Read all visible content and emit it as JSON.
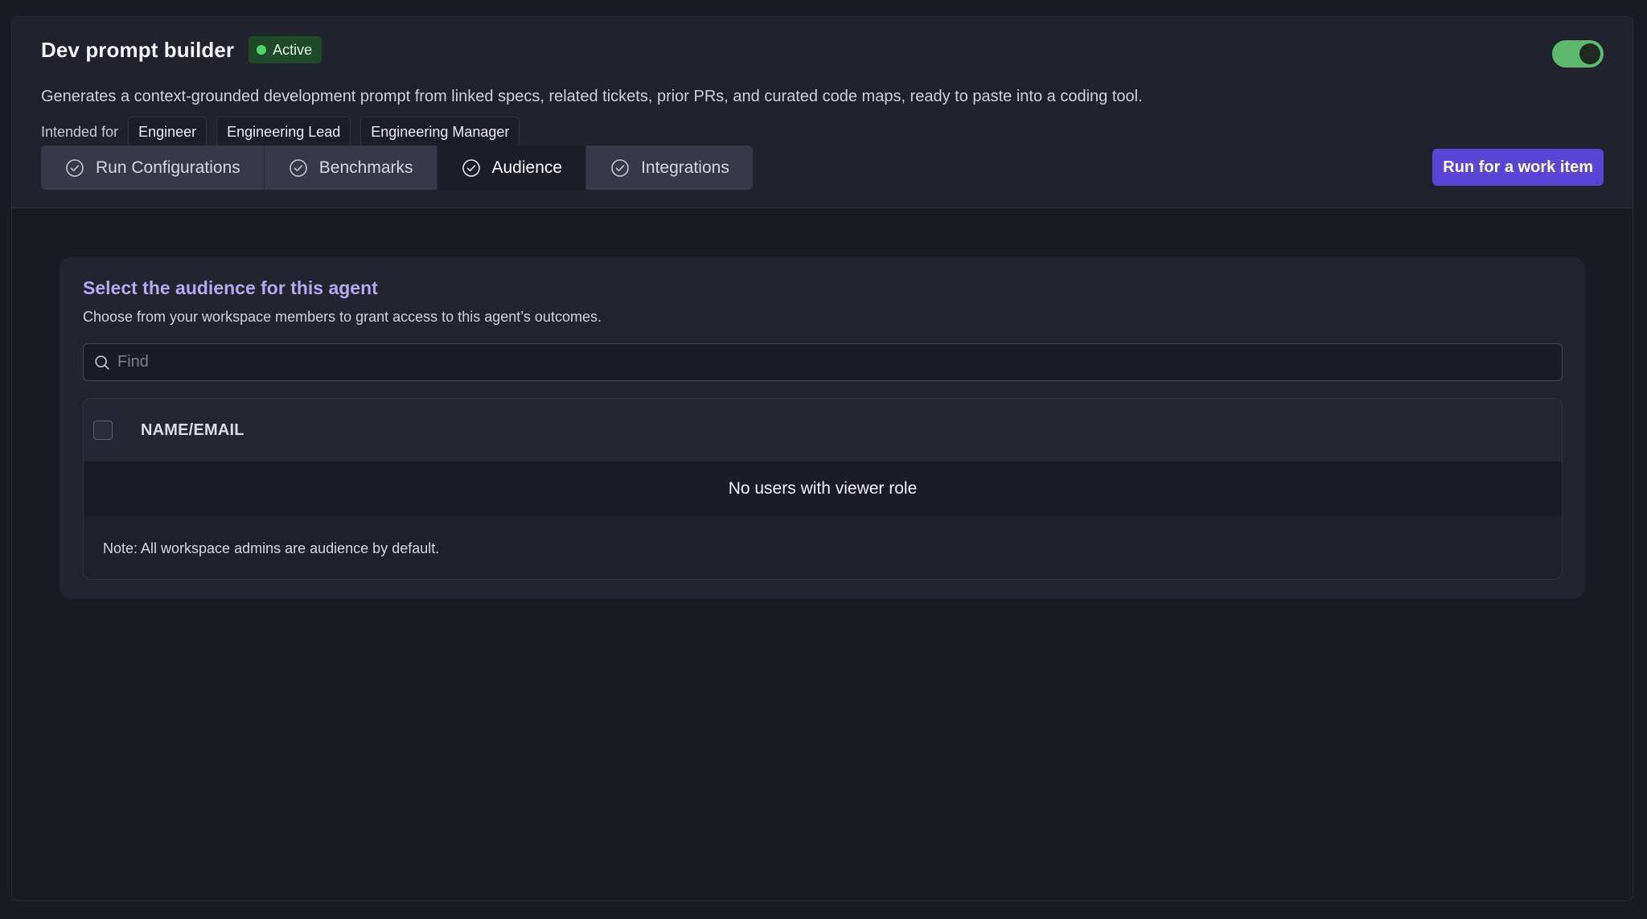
{
  "agent": {
    "title": "Dev prompt builder",
    "status": "Active",
    "status_color": "#4fd46c",
    "enabled": true,
    "description": "Generates a context-grounded development prompt from linked specs, related tickets, prior PRs, and curated code maps, ready to paste into a coding tool.",
    "intended_label": "Intended for",
    "roles": [
      "Engineer",
      "Engineering Lead",
      "Engineering Manager"
    ]
  },
  "tabs": [
    {
      "label": "Run Configurations",
      "icon": "check-circle-icon",
      "active": false
    },
    {
      "label": "Benchmarks",
      "icon": "check-circle-icon",
      "active": false
    },
    {
      "label": "Audience",
      "icon": "check-circle-icon",
      "active": true
    },
    {
      "label": "Integrations",
      "icon": "check-circle-icon",
      "active": false
    }
  ],
  "actions": {
    "run_label": "Run for a work item",
    "accent": "#5b45d6"
  },
  "audience": {
    "title": "Select the audience for this agent",
    "subtitle": "Choose from your workspace members to grant access to this agent’s outcomes.",
    "search": {
      "placeholder": "Find",
      "value": ""
    },
    "table": {
      "column_header": "NAME/EMAIL",
      "empty_message": "No users with viewer role",
      "note": "Note: All workspace admins are audience by default."
    }
  }
}
